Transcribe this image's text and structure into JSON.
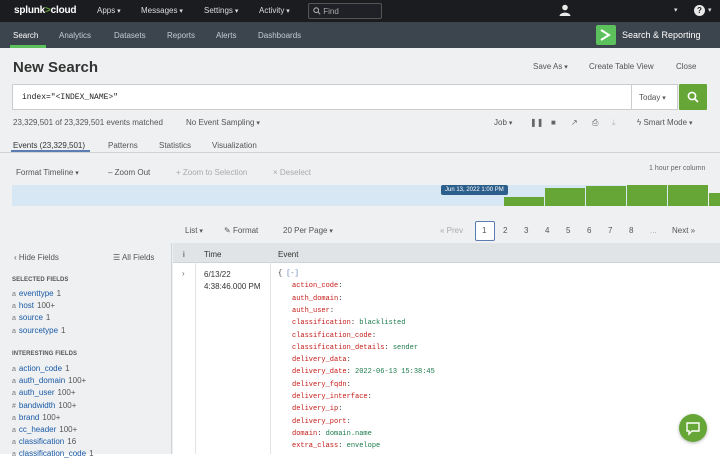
{
  "brand": {
    "name": "splunk",
    "gt": ">",
    "product": "cloud"
  },
  "topnav": {
    "apps": "Apps",
    "messages": "Messages",
    "settings": "Settings",
    "activity": "Activity",
    "find_placeholder": "Find"
  },
  "subnav": {
    "tabs": [
      "Search",
      "Analytics",
      "Datasets",
      "Reports",
      "Alerts",
      "Dashboards"
    ],
    "app_title": "Search & Reporting"
  },
  "page": {
    "title": "New Search",
    "save_as": "Save As",
    "create_table_view": "Create Table View",
    "close": "Close"
  },
  "search": {
    "query": "index=\"<INDEX_NAME>\"",
    "time_range": "Today"
  },
  "status": {
    "matched": "23,329,501 of 23,329,501 events matched",
    "sampling": "No Event Sampling",
    "job": "Job",
    "smart_mode": "Smart Mode"
  },
  "result_tabs": [
    "Events (23,329,501)",
    "Patterns",
    "Statistics",
    "Visualization"
  ],
  "timeline": {
    "format": "Format Timeline",
    "zoom_out": "Zoom Out",
    "zoom_selection": "+ Zoom to Selection",
    "deselect": "× Deselect",
    "per_column": "1 hour per column",
    "tooltip": "Jun 13, 2022 1:00 PM",
    "bars": [
      0.45,
      0.85,
      0.95,
      1.0,
      0.98,
      0.62
    ]
  },
  "list_controls": {
    "list": "List",
    "format": "Format",
    "per_page": "20 Per Page"
  },
  "pagination": {
    "prev": "« Prev",
    "pages": [
      "1",
      "2",
      "3",
      "4",
      "5",
      "6",
      "7",
      "8",
      "..."
    ],
    "next": "Next »",
    "active": "1"
  },
  "sidebar": {
    "hide_fields": "Hide Fields",
    "all_fields": "All Fields",
    "selected_heading": "SELECTED FIELDS",
    "selected": [
      {
        "type": "a",
        "name": "eventtype",
        "count": "1"
      },
      {
        "type": "a",
        "name": "host",
        "count": "100+"
      },
      {
        "type": "a",
        "name": "source",
        "count": "1"
      },
      {
        "type": "a",
        "name": "sourcetype",
        "count": "1"
      }
    ],
    "interesting_heading": "INTERESTING FIELDS",
    "interesting": [
      {
        "type": "a",
        "name": "action_code",
        "count": "1"
      },
      {
        "type": "a",
        "name": "auth_domain",
        "count": "100+"
      },
      {
        "type": "a",
        "name": "auth_user",
        "count": "100+"
      },
      {
        "type": "#",
        "name": "bandwidth",
        "count": "100+"
      },
      {
        "type": "a",
        "name": "brand",
        "count": "100+"
      },
      {
        "type": "a",
        "name": "cc_header",
        "count": "100+"
      },
      {
        "type": "a",
        "name": "classification",
        "count": "16"
      },
      {
        "type": "a",
        "name": "classification_code",
        "count": "1"
      }
    ]
  },
  "events": {
    "col_info": "i",
    "col_time": "Time",
    "col_event": "Event",
    "rows": [
      {
        "date": "6/13/22",
        "time": "4:38:46.000 PM",
        "open": "{",
        "collapse": "[-]",
        "fields": [
          {
            "key": "action_code",
            "value": ""
          },
          {
            "key": "auth_domain",
            "value": ""
          },
          {
            "key": "auth_user",
            "value": ""
          },
          {
            "key": "classification",
            "value": "blacklisted"
          },
          {
            "key": "classification_code",
            "value": ""
          },
          {
            "key": "classification_details",
            "value": "sender"
          },
          {
            "key": "delivery_data",
            "value": ""
          },
          {
            "key": "delivery_date",
            "value": "2022-06-13 15:38:45"
          },
          {
            "key": "delivery_fqdn",
            "value": ""
          },
          {
            "key": "delivery_interface",
            "value": ""
          },
          {
            "key": "delivery_ip",
            "value": ""
          },
          {
            "key": "delivery_port",
            "value": ""
          },
          {
            "key": "domain",
            "value": "domain.name"
          },
          {
            "key": "extra_class",
            "value": "envelope"
          }
        ]
      }
    ]
  },
  "colors": {
    "accent": "#65a637",
    "topbar": "#1a1c20",
    "subbar": "#3c444d",
    "link": "#1a5aa6",
    "json_key": "#c41a16",
    "json_value": "#1a7a4a"
  }
}
